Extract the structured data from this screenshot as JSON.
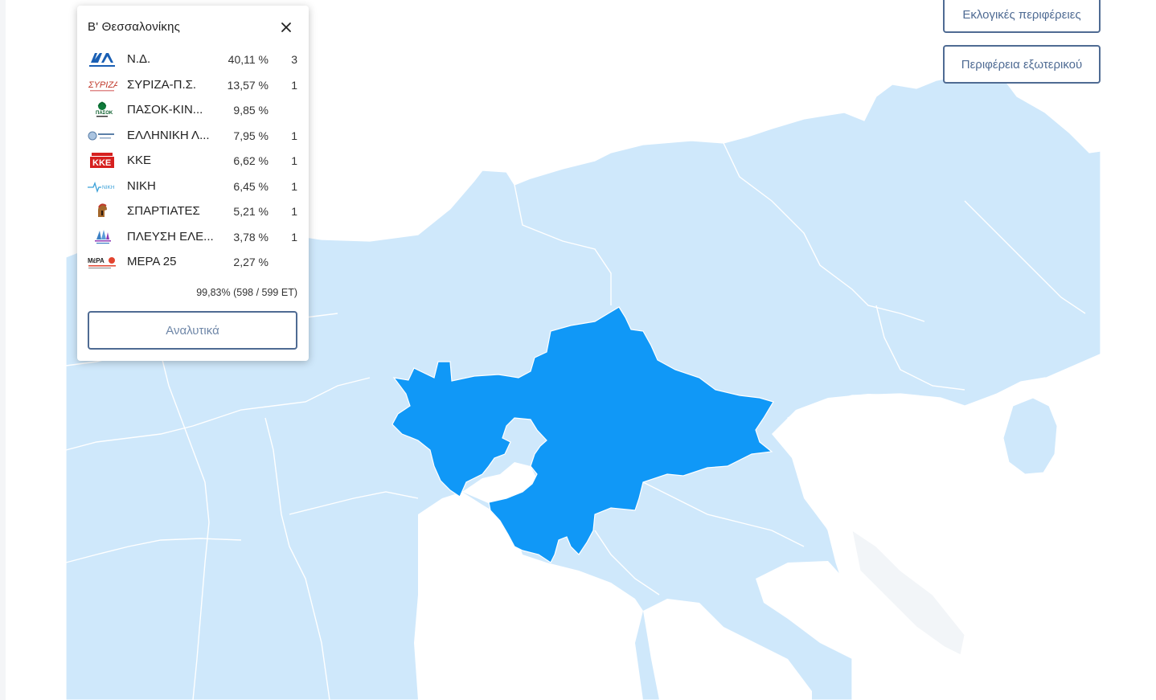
{
  "map_buttons": {
    "electoral_regions": "Εκλογικές περιφέρειες",
    "abroad_region": "Περιφέρεια εξωτερικού"
  },
  "popup": {
    "title": "Β' Θεσσαλονίκης",
    "parties": [
      {
        "name": "Ν.Δ.",
        "percent": "40,11 %",
        "seats": "3",
        "logo": "nd-logo"
      },
      {
        "name": "ΣΥΡΙΖΑ-Π.Σ.",
        "percent": "13,57 %",
        "seats": "1",
        "logo": "syriza-logo"
      },
      {
        "name": "ΠΑΣΟΚ-ΚΙΝ...",
        "percent": "9,85 %",
        "seats": "",
        "logo": "pasok-logo"
      },
      {
        "name": "ΕΛΛΗΝΙΚΗ Λ...",
        "percent": "7,95 %",
        "seats": "1",
        "logo": "elliniki-lysi-logo"
      },
      {
        "name": "ΚΚΕ",
        "percent": "6,62 %",
        "seats": "1",
        "logo": "kke-logo"
      },
      {
        "name": "ΝΙΚΗ",
        "percent": "6,45 %",
        "seats": "1",
        "logo": "niki-logo"
      },
      {
        "name": "ΣΠΑΡΤΙΑΤΕΣ",
        "percent": "5,21 %",
        "seats": "1",
        "logo": "spartiates-logo"
      },
      {
        "name": "ΠΛΕΥΣΗ ΕΛΕ...",
        "percent": "3,78 %",
        "seats": "1",
        "logo": "plefsi-logo"
      },
      {
        "name": "ΜΕΡΑ 25",
        "percent": "2,27 %",
        "seats": "",
        "logo": "mera25-logo"
      }
    ],
    "counted": "99,83% (598 / 599 ΕΤ)",
    "details_label": "Αναλυτικά"
  },
  "colors": {
    "selected_region": "#1098f7",
    "other_regions": "#cfe8fb",
    "region_border": "#ffffff",
    "sea": "#ffffff",
    "button_border": "#4f6b93"
  }
}
